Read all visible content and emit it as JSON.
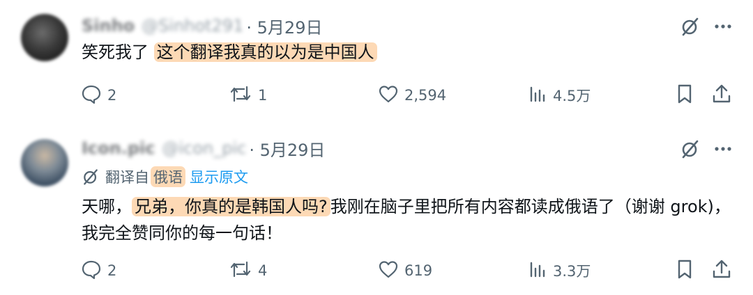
{
  "posts": [
    {
      "author_name": "Sinho",
      "author_handle": "@Sinhot291",
      "date": "· 5月29日",
      "text_plain": "笑死我了",
      "text_highlight": "这个翻译我真的以为是中国人",
      "replies": "2",
      "reposts": "1",
      "likes": "2,594",
      "views": "4.5万"
    },
    {
      "author_name": "Icon.pic",
      "author_handle": "@icon_pic",
      "date": "· 5月29日",
      "translated_prefix": "翻译自",
      "translated_lang": "俄语",
      "show_original": "显示原文",
      "text_before": "天哪，",
      "text_highlight": "兄弟，你真的是韩国人吗?",
      "text_after": "我刚在脑子里把所有内容都读成俄语了（谢谢 grok)，我完全赞同你的每一句话！",
      "replies": "2",
      "reposts": "4",
      "likes": "619",
      "views": "3.3万"
    }
  ],
  "colors": {
    "muted": "#536471",
    "link": "#1d9bf0",
    "highlight": "#fdd9b5",
    "text": "#0f1419"
  }
}
